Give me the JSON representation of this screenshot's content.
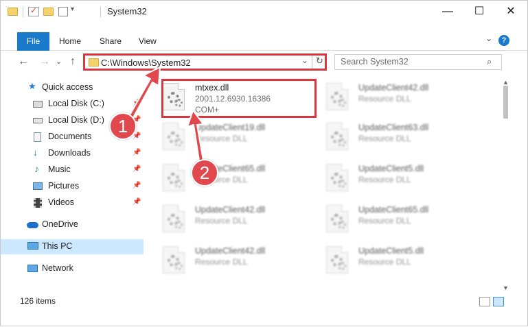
{
  "window": {
    "title": "System32",
    "controls": {
      "minimize": "—",
      "maximize": "☐",
      "close": "✕"
    }
  },
  "ribbon": {
    "file_tab": "File",
    "tabs": [
      "Home",
      "Share",
      "View"
    ],
    "collapse": "⌄",
    "help": "?"
  },
  "address": {
    "path": "C:\\Windows\\System32",
    "dropdown": "⌄",
    "refresh": "↻"
  },
  "search": {
    "placeholder": "Search System32",
    "icon": "search-icon"
  },
  "nav": {
    "back": "←",
    "forward": "→",
    "recent": "⌄",
    "up": "↑"
  },
  "navpane": [
    {
      "label": "Quick access",
      "icon": "star-icon",
      "pinned": false
    },
    {
      "label": "Local Disk (C:)",
      "icon": "drive-icon",
      "pinned": true
    },
    {
      "label": "Local Disk (D:)",
      "icon": "drive-icon",
      "pinned": true
    },
    {
      "label": "Documents",
      "icon": "documents-icon",
      "pinned": true
    },
    {
      "label": "Downloads",
      "icon": "download-icon",
      "pinned": true
    },
    {
      "label": "Music",
      "icon": "music-icon",
      "pinned": true
    },
    {
      "label": "Pictures",
      "icon": "pictures-icon",
      "pinned": true
    },
    {
      "label": "Videos",
      "icon": "videos-icon",
      "pinned": true
    },
    {
      "label": "OneDrive",
      "icon": "cloud-icon",
      "pinned": false
    },
    {
      "label": "This PC",
      "icon": "computer-icon",
      "pinned": false,
      "selected": true
    },
    {
      "label": "Network",
      "icon": "network-icon",
      "pinned": false
    }
  ],
  "files": [
    {
      "name": "mtxex.dll",
      "line2": "2001.12.6930.16386",
      "line3": "COM+",
      "highlighted": true
    },
    {
      "name": "UpdateClient42.dll",
      "line2": "Resource DLL"
    },
    {
      "name": "UpdateClient19.dll",
      "line2": "Resource DLL"
    },
    {
      "name": "UpdateClient63.dll",
      "line2": "Resource DLL"
    },
    {
      "name": "UpdateClient65.dll",
      "line2": "Resource DLL"
    },
    {
      "name": "UpdateClient5.dll",
      "line2": "Resource DLL"
    },
    {
      "name": "UpdateClient42.dll",
      "line2": "Resource DLL"
    },
    {
      "name": "UpdateClient65.dll",
      "line2": "Resource DLL"
    },
    {
      "name": "UpdateClient42.dll",
      "line2": "Resource DLL"
    },
    {
      "name": "UpdateClient5.dll",
      "line2": "Resource DLL"
    }
  ],
  "status": {
    "item_count": "126 items"
  },
  "callouts": {
    "step1": "1",
    "step2": "2",
    "color": "#e0484e"
  },
  "colors": {
    "accent": "#1979ca",
    "highlight": "#d9363e",
    "selected_bg": "#cce8ff"
  }
}
